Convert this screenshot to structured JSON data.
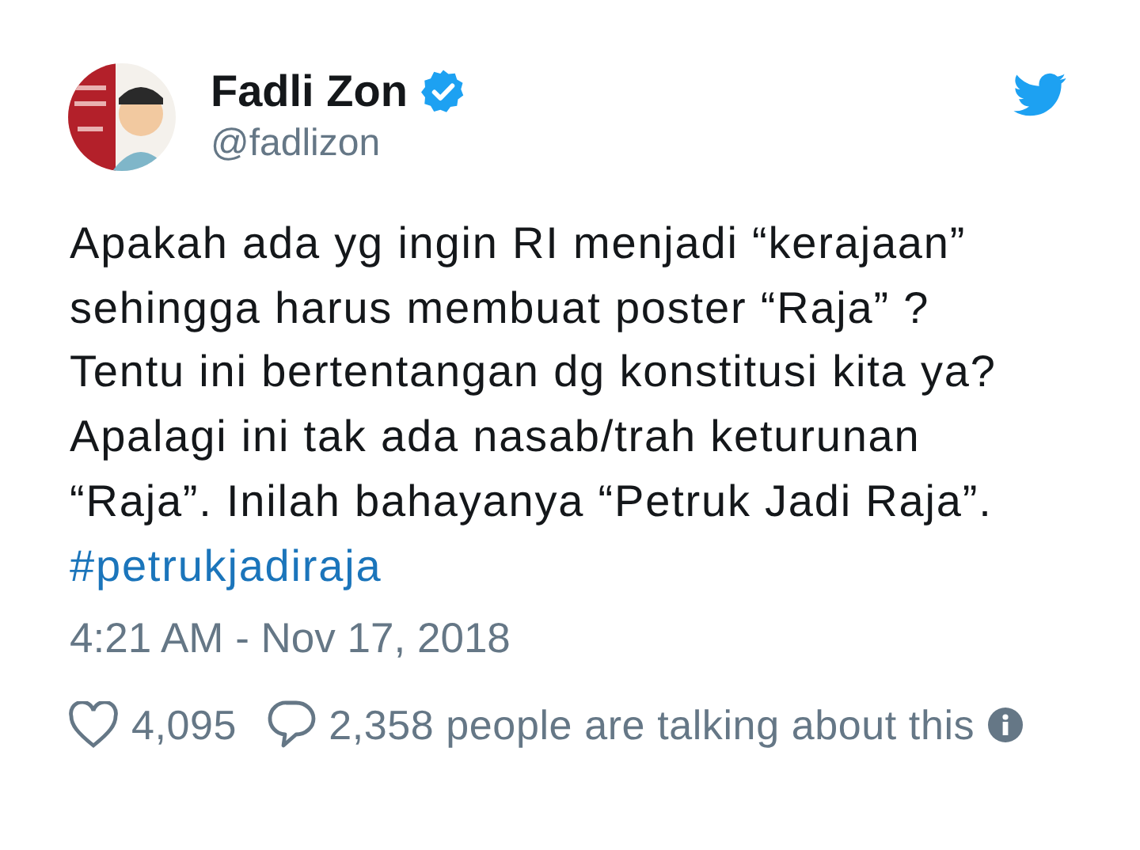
{
  "author": {
    "name": "Fadli Zon",
    "handle": "@fadlizon",
    "verified": true
  },
  "tweet": {
    "text": "Apakah ada yg ingin RI menjadi “kerajaan”\nsehingga harus membuat poster “Raja” ?\nTentu ini bertentangan dg konstitusi kita ya?\nApalagi ini tak ada nasab/trah keturunan\n“Raja”. Inilah bahayanya “Petruk Jadi Raja”.",
    "hashtag": "#petrukjadiraja",
    "timestamp": "4:21 AM - Nov 17, 2018"
  },
  "footer": {
    "likes": "4,095",
    "talking": "2,358 people are talking about this"
  }
}
